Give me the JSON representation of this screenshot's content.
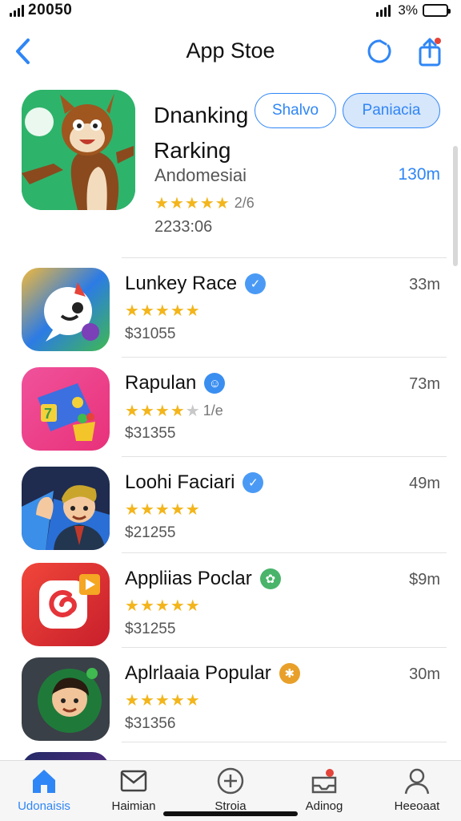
{
  "status_bar": {
    "time": "20050",
    "battery_percent": "3%"
  },
  "nav": {
    "title": "App Stoe"
  },
  "featured": {
    "title": "Dnanking Rarking",
    "chip_1": "Shalvo",
    "chip_2": "Paniacia",
    "subtitle": "Andomesiai",
    "size": "130m",
    "rating_stars": 4.5,
    "rating_text": "2/6",
    "count": "2233:06"
  },
  "apps": [
    {
      "name": "Lunkey Race",
      "size": "33m",
      "price": "$31055",
      "stars": 4.5,
      "badge_color": "#4a9af5"
    },
    {
      "name": "Rapulan",
      "size": "73m",
      "price": "$31355",
      "stars": 4,
      "extra": "1/e",
      "badge_color": "#3a8ef0"
    },
    {
      "name": "Loohi Faciari",
      "size": "49m",
      "price": "$21255",
      "stars": 4.5,
      "badge_color": "#4a9af5"
    },
    {
      "name": "Appliias Poclar",
      "size": "$9m",
      "price": "$31255",
      "stars": 4.5,
      "badge_color": "#49b46a"
    },
    {
      "name": "Aplrlaaia Popular",
      "size": "30m",
      "price": "$31356",
      "stars": 4.5,
      "badge_color": "#e8a02a"
    }
  ],
  "tab_bar": {
    "tabs": [
      {
        "label": "Udonaisis",
        "icon": "home-icon",
        "active": true
      },
      {
        "label": "Haimian",
        "icon": "mail-icon",
        "active": false
      },
      {
        "label": "Stroia",
        "icon": "add-circle-icon",
        "active": false
      },
      {
        "label": "Adinog",
        "icon": "inbox-badge-icon",
        "active": false
      },
      {
        "label": "Heeoaat",
        "icon": "profile-icon",
        "active": false
      }
    ]
  },
  "colors": {
    "accent": "#2f86f6",
    "star": "#f3b51b"
  }
}
